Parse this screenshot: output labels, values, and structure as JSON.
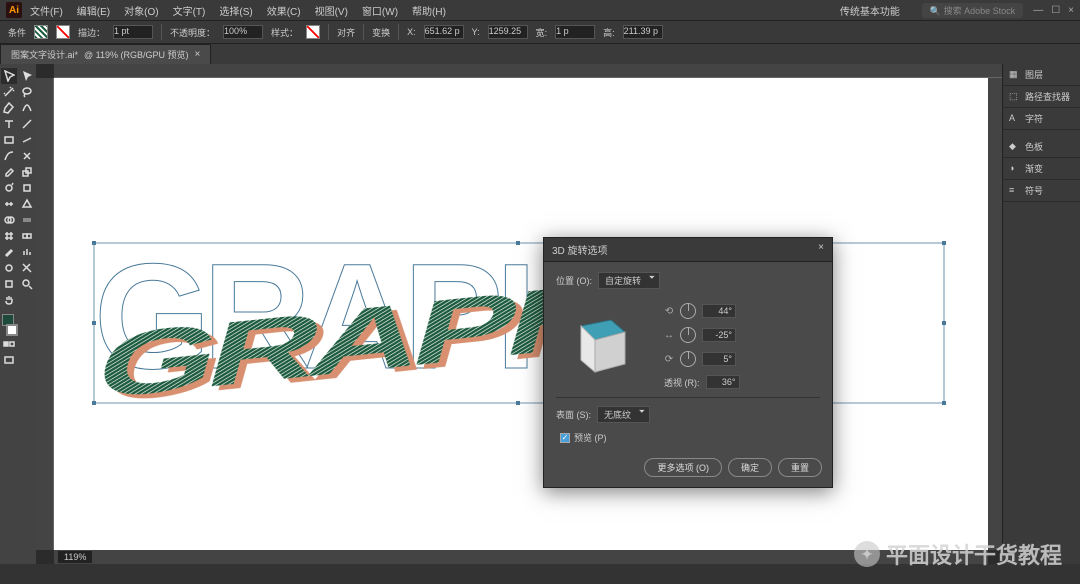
{
  "app": {
    "logo_letter": "Ai",
    "title": "传统基本功能"
  },
  "menu": [
    "文件(F)",
    "编辑(E)",
    "对象(O)",
    "文字(T)",
    "选择(S)",
    "效果(C)",
    "视图(V)",
    "窗口(W)",
    "帮助(H)"
  ],
  "window_controls": {
    "min": "—",
    "max": "☐",
    "close": "×"
  },
  "top_search": {
    "placeholder": "搜索 Adobe Stock",
    "icon": "🔍"
  },
  "optbar": {
    "label_select": "条件",
    "stroke_label": "描边：",
    "stroke_pt": "1 pt",
    "opacity_label": "不透明度：",
    "opacity_val": "100%",
    "style_label": "样式：",
    "align_label": "对齐",
    "transform_label": "变换",
    "x_label": "X:",
    "x_val": "651.62 p",
    "y_label": "Y:",
    "y_val": "1259.25",
    "w_label": "宽:",
    "w_val": "1 p",
    "h_label": "高:",
    "h_val": "211.39 p"
  },
  "doc_tab": {
    "name": "图案文字设计.ai*",
    "suffix": "@ 119% (RGB/GPU 预览)",
    "close": "×"
  },
  "toolbar_labels": [
    "selection",
    "direct-selection",
    "magic-wand",
    "lasso",
    "pen",
    "curvature",
    "type",
    "line",
    "rectangle",
    "brush",
    "shaper",
    "eraser",
    "rotate",
    "scale",
    "width",
    "free-transform",
    "shape-builder",
    "perspective",
    "mesh",
    "gradient",
    "eyedropper",
    "blend",
    "symbol-sprayer",
    "graph",
    "artboard",
    "slice",
    "hand",
    "zoom"
  ],
  "zoom_status": "119%",
  "canvas_text": "GRAPHIC",
  "right_panel": {
    "items": [
      {
        "icon": "▦",
        "label": "图层"
      },
      {
        "icon": "⬚",
        "label": "路径查找器"
      },
      {
        "icon": "A",
        "label": "字符"
      }
    ],
    "groups": [
      {
        "icon": "◆",
        "label": "色板"
      },
      {
        "icon": "◑",
        "label": "渐变"
      },
      {
        "icon": "≡",
        "label": "符号"
      }
    ]
  },
  "dialog": {
    "title": "3D 旋转选项",
    "position_label": "位置 (O):",
    "position_value": "自定旋转",
    "axes": [
      {
        "sym": "⟲",
        "lbl": "",
        "val": "44°"
      },
      {
        "sym": "↔",
        "lbl": "",
        "val": "-25°"
      },
      {
        "sym": "⟳",
        "lbl": "",
        "val": "5°"
      }
    ],
    "perspective_label": "透视 (R):",
    "perspective_value": "36°",
    "surface_label": "表面 (S):",
    "surface_value": "无底纹",
    "preview_chk": "预览 (P)",
    "buttons": {
      "more": "更多选项 (O)",
      "ok": "确定",
      "cancel": "重置"
    }
  },
  "watermark": "平面设计干货教程"
}
